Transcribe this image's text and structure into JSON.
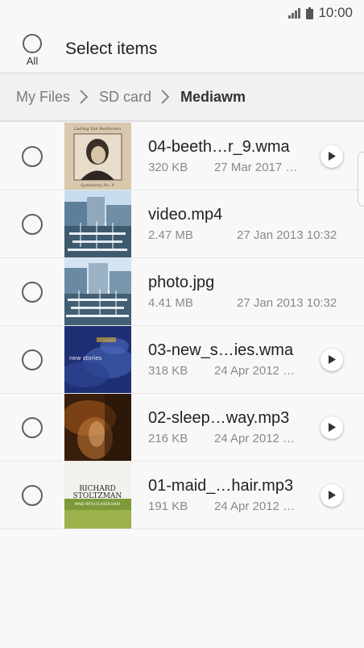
{
  "status_bar": {
    "time": "10:00"
  },
  "header": {
    "select_all_label": "All",
    "title": "Select items"
  },
  "breadcrumb": {
    "items": [
      "My Files",
      "SD card"
    ],
    "current": "Mediawm"
  },
  "files": [
    {
      "name": "04-beeth…r_9.wma",
      "size": "320 KB",
      "date": "27 Mar 2017 …",
      "thumb": "beethoven-icon",
      "playable": true
    },
    {
      "name": "video.mp4",
      "size": "2.47 MB",
      "date": "27 Jan 2013 10:32",
      "thumb": "harbor-icon",
      "playable": false
    },
    {
      "name": "photo.jpg",
      "size": "4.41 MB",
      "date": "27 Jan 2013 10:32",
      "thumb": "harbor-icon",
      "playable": false
    },
    {
      "name": "03-new_s…ies.wma",
      "size": "318 KB",
      "date": "24 Apr 2012 …",
      "thumb": "new-stories-icon",
      "playable": true
    },
    {
      "name": "02-sleep…way.mp3",
      "size": "216 KB",
      "date": "24 Apr 2012 …",
      "thumb": "sleep-away-icon",
      "playable": true
    },
    {
      "name": "01-maid_…hair.mp3",
      "size": "191 KB",
      "date": "24 Apr 2012 …",
      "thumb": "richard-stoltzman-icon",
      "playable": true
    }
  ],
  "album_text": {
    "beethoven_top": "Ludwig Van Beethoven",
    "beethoven_bottom": "Symphony No. 9",
    "new_stories": "new stories",
    "stoltzman_line1": "RICHARD",
    "stoltzman_line2": "STOLTZMAN",
    "stoltzman_line3": "MAID WITH FLAXEN HAIR"
  },
  "colors": {
    "background": "#f8f8f8",
    "breadcrumb_bg": "#f1f1f1",
    "text": "#222222",
    "meta": "#8a8a8a"
  }
}
